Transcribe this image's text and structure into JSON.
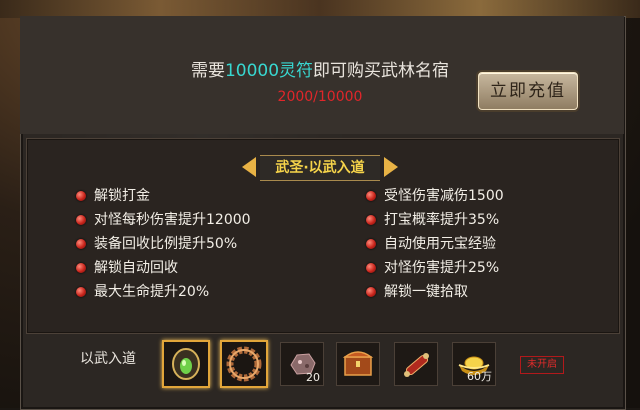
{
  "header": {
    "requirement_prefix": "需要",
    "requirement_amount": "10000灵符",
    "requirement_suffix": "即可购买武林名宿",
    "progress": "2000/10000",
    "recharge_button": "立即充值"
  },
  "section": {
    "title": "武圣·以武入道"
  },
  "perks_left": [
    "解锁打金",
    "对怪每秒伤害提升12000",
    "装备回收比例提升50%",
    "解锁自动回收",
    "最大生命提升20%"
  ],
  "perks_right": [
    "受怪伤害减伤1500",
    "打宝概率提升35%",
    "自动使用元宝经验",
    "对怪伤害提升25%",
    "解锁一键拾取"
  ],
  "rewards": {
    "label": "以武入道",
    "items": [
      {
        "icon": "green-amulet-icon",
        "count": ""
      },
      {
        "icon": "bead-bracelet-icon",
        "count": ""
      },
      {
        "icon": "ore-stone-icon",
        "count": "20"
      },
      {
        "icon": "treasure-chest-icon",
        "count": ""
      },
      {
        "icon": "scroll-icon",
        "count": ""
      },
      {
        "icon": "gold-ingot-icon",
        "count": "60万"
      }
    ],
    "status": "未开启"
  },
  "colors": {
    "accent": "#38d7d0",
    "progress": "#e0262a",
    "title": "#f6d44a"
  }
}
